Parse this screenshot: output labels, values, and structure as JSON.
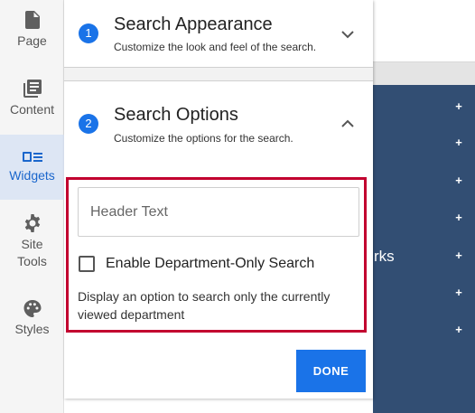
{
  "rail": {
    "items": [
      {
        "label": "Page",
        "icon": "page-icon"
      },
      {
        "label": "Content",
        "icon": "content-icon"
      },
      {
        "label": "Widgets",
        "icon": "widgets-icon",
        "active": true
      },
      {
        "label": "Site\nTools",
        "icon": "gear-icon"
      },
      {
        "label": "Styles",
        "icon": "palette-icon"
      }
    ]
  },
  "sections": [
    {
      "number": "1",
      "title": "Search Appearance",
      "subtitle": "Customize the look and feel of the search.",
      "expanded": false
    },
    {
      "number": "2",
      "title": "Search Options",
      "subtitle": "Customize the options for the search.",
      "expanded": true
    }
  ],
  "options": {
    "header_text_placeholder": "Header Text",
    "header_text_value": "",
    "checkbox_label": "Enable Department-Only Search",
    "checkbox_checked": false,
    "help_text": "Display an option to search only the currently viewed department"
  },
  "done_label": "DONE",
  "background": {
    "nav_text": "rks",
    "plus": "+"
  },
  "colors": {
    "accent": "#1a73e8",
    "highlight": "#c2002f",
    "nav_bg": "#324e73"
  }
}
